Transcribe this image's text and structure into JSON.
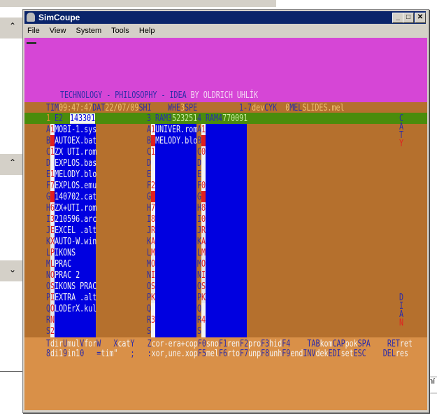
{
  "window": {
    "title": "SimCoupe",
    "minimize": "_",
    "maximize": "□",
    "close": "✕"
  },
  "menu": [
    "File",
    "View",
    "System",
    "Tools",
    "Help"
  ],
  "background": {
    "right_text": "ní"
  },
  "colors": {
    "magenta": "#d646d6",
    "brown": "#b5702d",
    "green": "#4a8c0c",
    "blue": "#0000e0",
    "orange": "#d99048",
    "ink": "#2c2ca8",
    "amber": "#f0c070",
    "red": "#e02020",
    "white": "#f4f4f4"
  },
  "screen": {
    "title": [
      [
        "TECHNOLOGY - PHILOSOPHY - IDEA",
        "ink"
      ],
      [
        " BY OLDRICH UHLÍK",
        "pinkwhite"
      ]
    ],
    "status": [
      [
        "TIM",
        "ink"
      ],
      [
        "09:47:47",
        "amber"
      ],
      [
        "DAT",
        "ink"
      ],
      [
        "22/07/09",
        "amber"
      ],
      [
        "SHI",
        "ink"
      ]
    ],
    "status2": [
      [
        "WHE",
        "ink"
      ],
      [
        "3",
        "amber"
      ],
      [
        "SPE",
        "ink"
      ]
    ],
    "status3": [
      [
        "1-7",
        "ink"
      ],
      [
        "dev",
        "amber"
      ],
      [
        "CYK",
        "ink"
      ],
      [
        "  ",
        "ink"
      ],
      [
        "0",
        "amber"
      ],
      [
        "MEL",
        "ink"
      ],
      [
        "SLIDES.mel",
        "amber"
      ]
    ],
    "panels": [
      {
        "num": "1",
        "drive": "E2",
        "free": "143301",
        "rows": [
          [
            "A",
            "1",
            "MOBI-1.sys"
          ],
          [
            "B",
            "",
            "AUTOEX.bat"
          ],
          [
            "C",
            "1",
            "ZX UTI.rom"
          ],
          [
            "D",
            "",
            "EXPLOS.bas"
          ],
          [
            "E",
            "1",
            "MELODY.blo"
          ],
          [
            "F",
            "7",
            "EXPLOS.emu"
          ],
          [
            "G",
            "",
            "140702.cat"
          ],
          [
            "H",
            "6",
            "ZX+UTI.rom"
          ],
          [
            "I",
            "3",
            "210596.arc"
          ],
          [
            "J",
            "E",
            "EXCEL .alt"
          ],
          [
            "K",
            "X",
            "AUTO-W.win"
          ],
          [
            "L",
            "P",
            "IKONS"
          ],
          [
            "M",
            "L",
            "PRAC"
          ],
          [
            "N",
            "O",
            "PRAC 2"
          ],
          [
            "O",
            "S",
            "IKONS PRAC"
          ],
          [
            "P",
            "I",
            "EXTRA .alt"
          ],
          [
            "Q",
            "O",
            "LODErX.kul"
          ],
          [
            "R",
            "N",
            ""
          ],
          [
            "S",
            "2",
            ""
          ]
        ]
      },
      {
        "num": "3",
        "drive": "RAM3",
        "free": "523251",
        "rows": [
          [
            "A",
            "1",
            "UNIVER.rom"
          ],
          [
            "B",
            "",
            "MELODY.blo"
          ],
          [
            "C",
            "1",
            ""
          ],
          [
            "D",
            "",
            ""
          ],
          [
            "E",
            "",
            ""
          ],
          [
            "F",
            "2",
            ""
          ],
          [
            "G",
            "",
            ""
          ],
          [
            "H",
            "7",
            ""
          ],
          [
            "I",
            "8",
            ""
          ],
          [
            "J",
            "R",
            ""
          ],
          [
            "K",
            "A",
            ""
          ],
          [
            "L",
            "M",
            ""
          ],
          [
            "M",
            "O",
            ""
          ],
          [
            "N",
            "I",
            ""
          ],
          [
            "O",
            "S",
            ""
          ],
          [
            "P",
            "K",
            ""
          ],
          [
            "Q",
            "",
            ""
          ],
          [
            "R",
            "3",
            ""
          ],
          [
            "S",
            "",
            ""
          ]
        ]
      },
      {
        "num": "4",
        "drive": "RAM4",
        "free": "770091",
        "rows": [
          [
            "A",
            "1",
            ""
          ],
          [
            "B",
            "",
            ""
          ],
          [
            "C",
            "0",
            ""
          ],
          [
            "D",
            "",
            ""
          ],
          [
            "E",
            "",
            ""
          ],
          [
            "F",
            "0",
            ""
          ],
          [
            "G",
            "",
            ""
          ],
          [
            "H",
            "8",
            ""
          ],
          [
            "I",
            "0",
            ""
          ],
          [
            "J",
            "R",
            ""
          ],
          [
            "K",
            "A",
            ""
          ],
          [
            "L",
            "M",
            ""
          ],
          [
            "M",
            "O",
            ""
          ],
          [
            "N",
            "I",
            ""
          ],
          [
            "O",
            "S",
            ""
          ],
          [
            "P",
            "K",
            ""
          ],
          [
            "Q",
            "",
            ""
          ],
          [
            "R",
            "4",
            ""
          ],
          [
            "S",
            "",
            ""
          ]
        ]
      }
    ],
    "side_top": [
      "C",
      "A",
      "T",
      "Y"
    ],
    "side_bottom": [
      "D",
      "I",
      "A",
      "N"
    ],
    "footer1": [
      [
        "T",
        "ink"
      ],
      [
        "dir",
        "white"
      ],
      [
        "U",
        "ink"
      ],
      [
        "mul",
        "white"
      ],
      [
        "V",
        "ink"
      ],
      [
        "for",
        "white"
      ],
      [
        "W",
        "ink"
      ],
      [
        "   ",
        "white"
      ],
      [
        "X",
        "ink"
      ],
      [
        "cat",
        "white"
      ],
      [
        "Y",
        "ink"
      ],
      [
        "   ",
        "white"
      ],
      [
        "Z",
        "ink"
      ],
      [
        "cor-era+cop",
        "white"
      ],
      [
        "F0",
        "ink"
      ],
      [
        "sno",
        "white"
      ],
      [
        "F1",
        "ink"
      ],
      [
        "ren",
        "white"
      ],
      [
        "F2",
        "ink"
      ],
      [
        "pro",
        "white"
      ],
      [
        "F3",
        "ink"
      ],
      [
        "hid",
        "white"
      ],
      [
        "F4",
        "ink"
      ],
      [
        "    ",
        "white"
      ],
      [
        "TAB",
        "ink"
      ],
      [
        "kom",
        "white"
      ],
      [
        "CAP",
        "ink"
      ],
      [
        "pok",
        "white"
      ],
      [
        "SPA",
        "ink"
      ],
      [
        "    ",
        "white"
      ],
      [
        "RET",
        "ink"
      ],
      [
        "ret",
        "white"
      ]
    ],
    "footer2": [
      [
        "8",
        "ink"
      ],
      [
        "di1",
        "white"
      ],
      [
        "9",
        "ink"
      ],
      [
        "in1",
        "white"
      ],
      [
        "0",
        "ink"
      ],
      [
        "   ",
        "white"
      ],
      [
        "=",
        "ink"
      ],
      [
        "tim\"",
        "white"
      ],
      [
        "   ",
        "white"
      ],
      [
        ";",
        "ink"
      ],
      [
        "   ",
        "white"
      ],
      [
        ":",
        "ink"
      ],
      [
        "xor,une.xop",
        "white"
      ],
      [
        "F5",
        "ink"
      ],
      [
        "mel",
        "white"
      ],
      [
        "F6",
        "ink"
      ],
      [
        "rto",
        "white"
      ],
      [
        "F7",
        "ink"
      ],
      [
        "unp",
        "white"
      ],
      [
        "F8",
        "ink"
      ],
      [
        "unh",
        "white"
      ],
      [
        "F9",
        "ink"
      ],
      [
        "end",
        "white"
      ],
      [
        "INV",
        "ink"
      ],
      [
        "dek",
        "white"
      ],
      [
        "EDI",
        "ink"
      ],
      [
        "set",
        "white"
      ],
      [
        "ESC",
        "ink"
      ],
      [
        "    ",
        "white"
      ],
      [
        "DEL",
        "ink"
      ],
      [
        "res",
        "white"
      ]
    ]
  }
}
